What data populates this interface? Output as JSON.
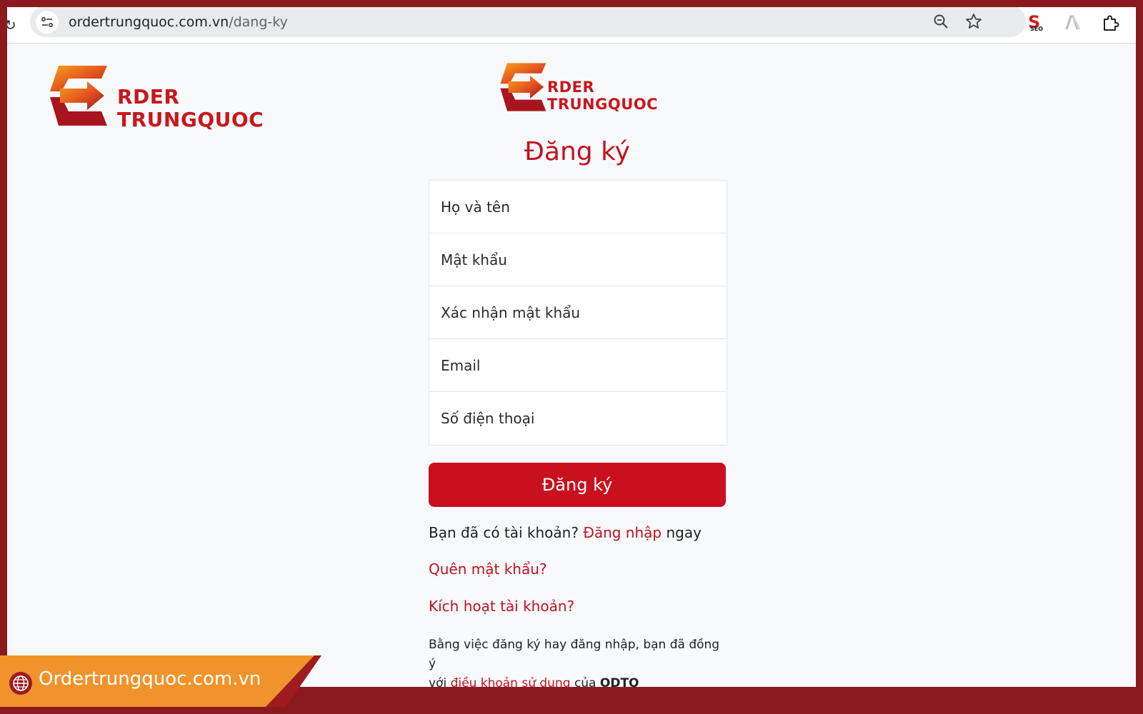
{
  "browser": {
    "url_host": "ordertrungquoc.com.vn",
    "url_path": "/dang-ky",
    "icons": [
      "site-info-icon",
      "zoom-icon",
      "bookmark-star-icon",
      "seo-extension-icon",
      "extension-icon-2",
      "extensions-puzzle-icon"
    ],
    "seo_badge": "SEO"
  },
  "logo": {
    "line1": "RDER",
    "line2": "TRUNGQUOC"
  },
  "page": {
    "title": "Đăng ký"
  },
  "form": {
    "fields": [
      {
        "placeholder": "Họ và tên",
        "value": ""
      },
      {
        "placeholder": "Mật khẩu",
        "value": ""
      },
      {
        "placeholder": "Xác nhận mật khẩu",
        "value": ""
      },
      {
        "placeholder": "Email",
        "value": ""
      },
      {
        "placeholder": "Số điện thoại",
        "value": ""
      }
    ],
    "submit_label": "Đăng ký"
  },
  "links": {
    "have_account_prefix": "Bạn đã có tài khoản?",
    "login_link": "Đăng nhập",
    "login_suffix": "ngay",
    "forgot_password": "Quên mật khẩu?",
    "activate_account": "Kích hoạt tài khoản?"
  },
  "terms": {
    "line1": "Bằng việc đăng ký hay đăng nhập, bạn đã đồng ý",
    "with": "với",
    "terms_link": "điều khoản sử dụng",
    "of": "của",
    "brand": "ODTQ"
  },
  "footer": {
    "site": "Ordertrungquoc.com.vn"
  },
  "colors": {
    "brand_red": "#c8101f",
    "frame_dark_red": "#8b1a1f",
    "banner_orange": "#f0932b"
  }
}
